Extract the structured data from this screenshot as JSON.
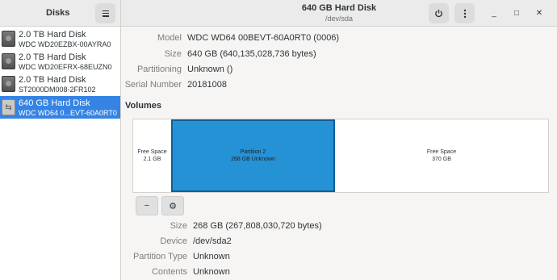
{
  "sidebar": {
    "title": "Disks",
    "menu_icon": "hamburger-icon",
    "disks": [
      {
        "name": "2.0 TB Hard Disk",
        "model": "WDC WD20EZBX-00AYRA0",
        "icon": "hard-disk-icon"
      },
      {
        "name": "2.0 TB Hard Disk",
        "model": "WDC WD20EFRX-68EUZN0",
        "icon": "hard-disk-icon"
      },
      {
        "name": "2.0 TB Hard Disk",
        "model": "ST2000DM008-2FR102",
        "icon": "hard-disk-icon"
      },
      {
        "name": "640 GB Hard Disk",
        "model": "WDC WD64 0...EVT-60A0RT0",
        "icon": "usb-disk-icon",
        "selected": true
      }
    ]
  },
  "header": {
    "title": "640 GB Hard Disk",
    "subtitle": "/dev/sda",
    "power_icon": "power-icon",
    "more_icon": "more-vertical-icon",
    "minimize_glyph": "_",
    "maximize_glyph": "□",
    "close_glyph": "✕"
  },
  "disk_info": {
    "model_label": "Model",
    "model_value": "WDC WD64 00BEVT-60A0RT0 (0006)",
    "size_label": "Size",
    "size_value": "640 GB (640,135,028,736 bytes)",
    "partitioning_label": "Partitioning",
    "partitioning_value": "Unknown ()",
    "serial_label": "Serial Number",
    "serial_value": "20181008"
  },
  "volumes": {
    "title": "Volumes",
    "segments": [
      {
        "line1": "Free Space",
        "line2": "2.1 GB",
        "type": "free"
      },
      {
        "line1": "Partition 2",
        "line2": "268 GB Unknown",
        "type": "partition",
        "selected": true
      },
      {
        "line1": "Free Space",
        "line2": "370 GB",
        "type": "free"
      }
    ],
    "minus_glyph": "−",
    "settings_glyph": "⚙"
  },
  "volume_info": {
    "size_label": "Size",
    "size_value": "268 GB (267,808,030,720 bytes)",
    "device_label": "Device",
    "device_value": "/dev/sda2",
    "ptype_label": "Partition Type",
    "ptype_value": "Unknown",
    "contents_label": "Contents",
    "contents_value": "Unknown"
  },
  "colors": {
    "accent": "#3584e4",
    "partition": "#2592d6"
  }
}
